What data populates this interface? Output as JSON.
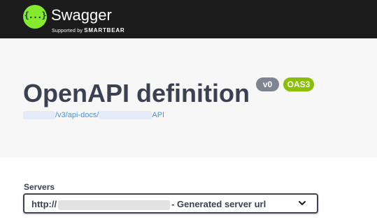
{
  "topbar": {
    "logo_glyph": "{...}",
    "brand_name": "Swagger",
    "tagline_prefix": "Supported by",
    "tagline_brand": "SMARTBEAR"
  },
  "info": {
    "title": "OpenAPI definition",
    "version_badge": "v0",
    "spec_badge": "OAS3",
    "link_path": "/v3/api-docs/",
    "link_suffix": "API"
  },
  "servers": {
    "label": "Servers",
    "selected_prefix": "http://",
    "selected_suffix": "- Generated server url"
  },
  "colors": {
    "accent_green": "#85ea2d",
    "topbar_bg": "#1b1b1b",
    "badge_version": "#7d8492",
    "badge_oas": "#89bf04",
    "link": "#4990e2"
  }
}
